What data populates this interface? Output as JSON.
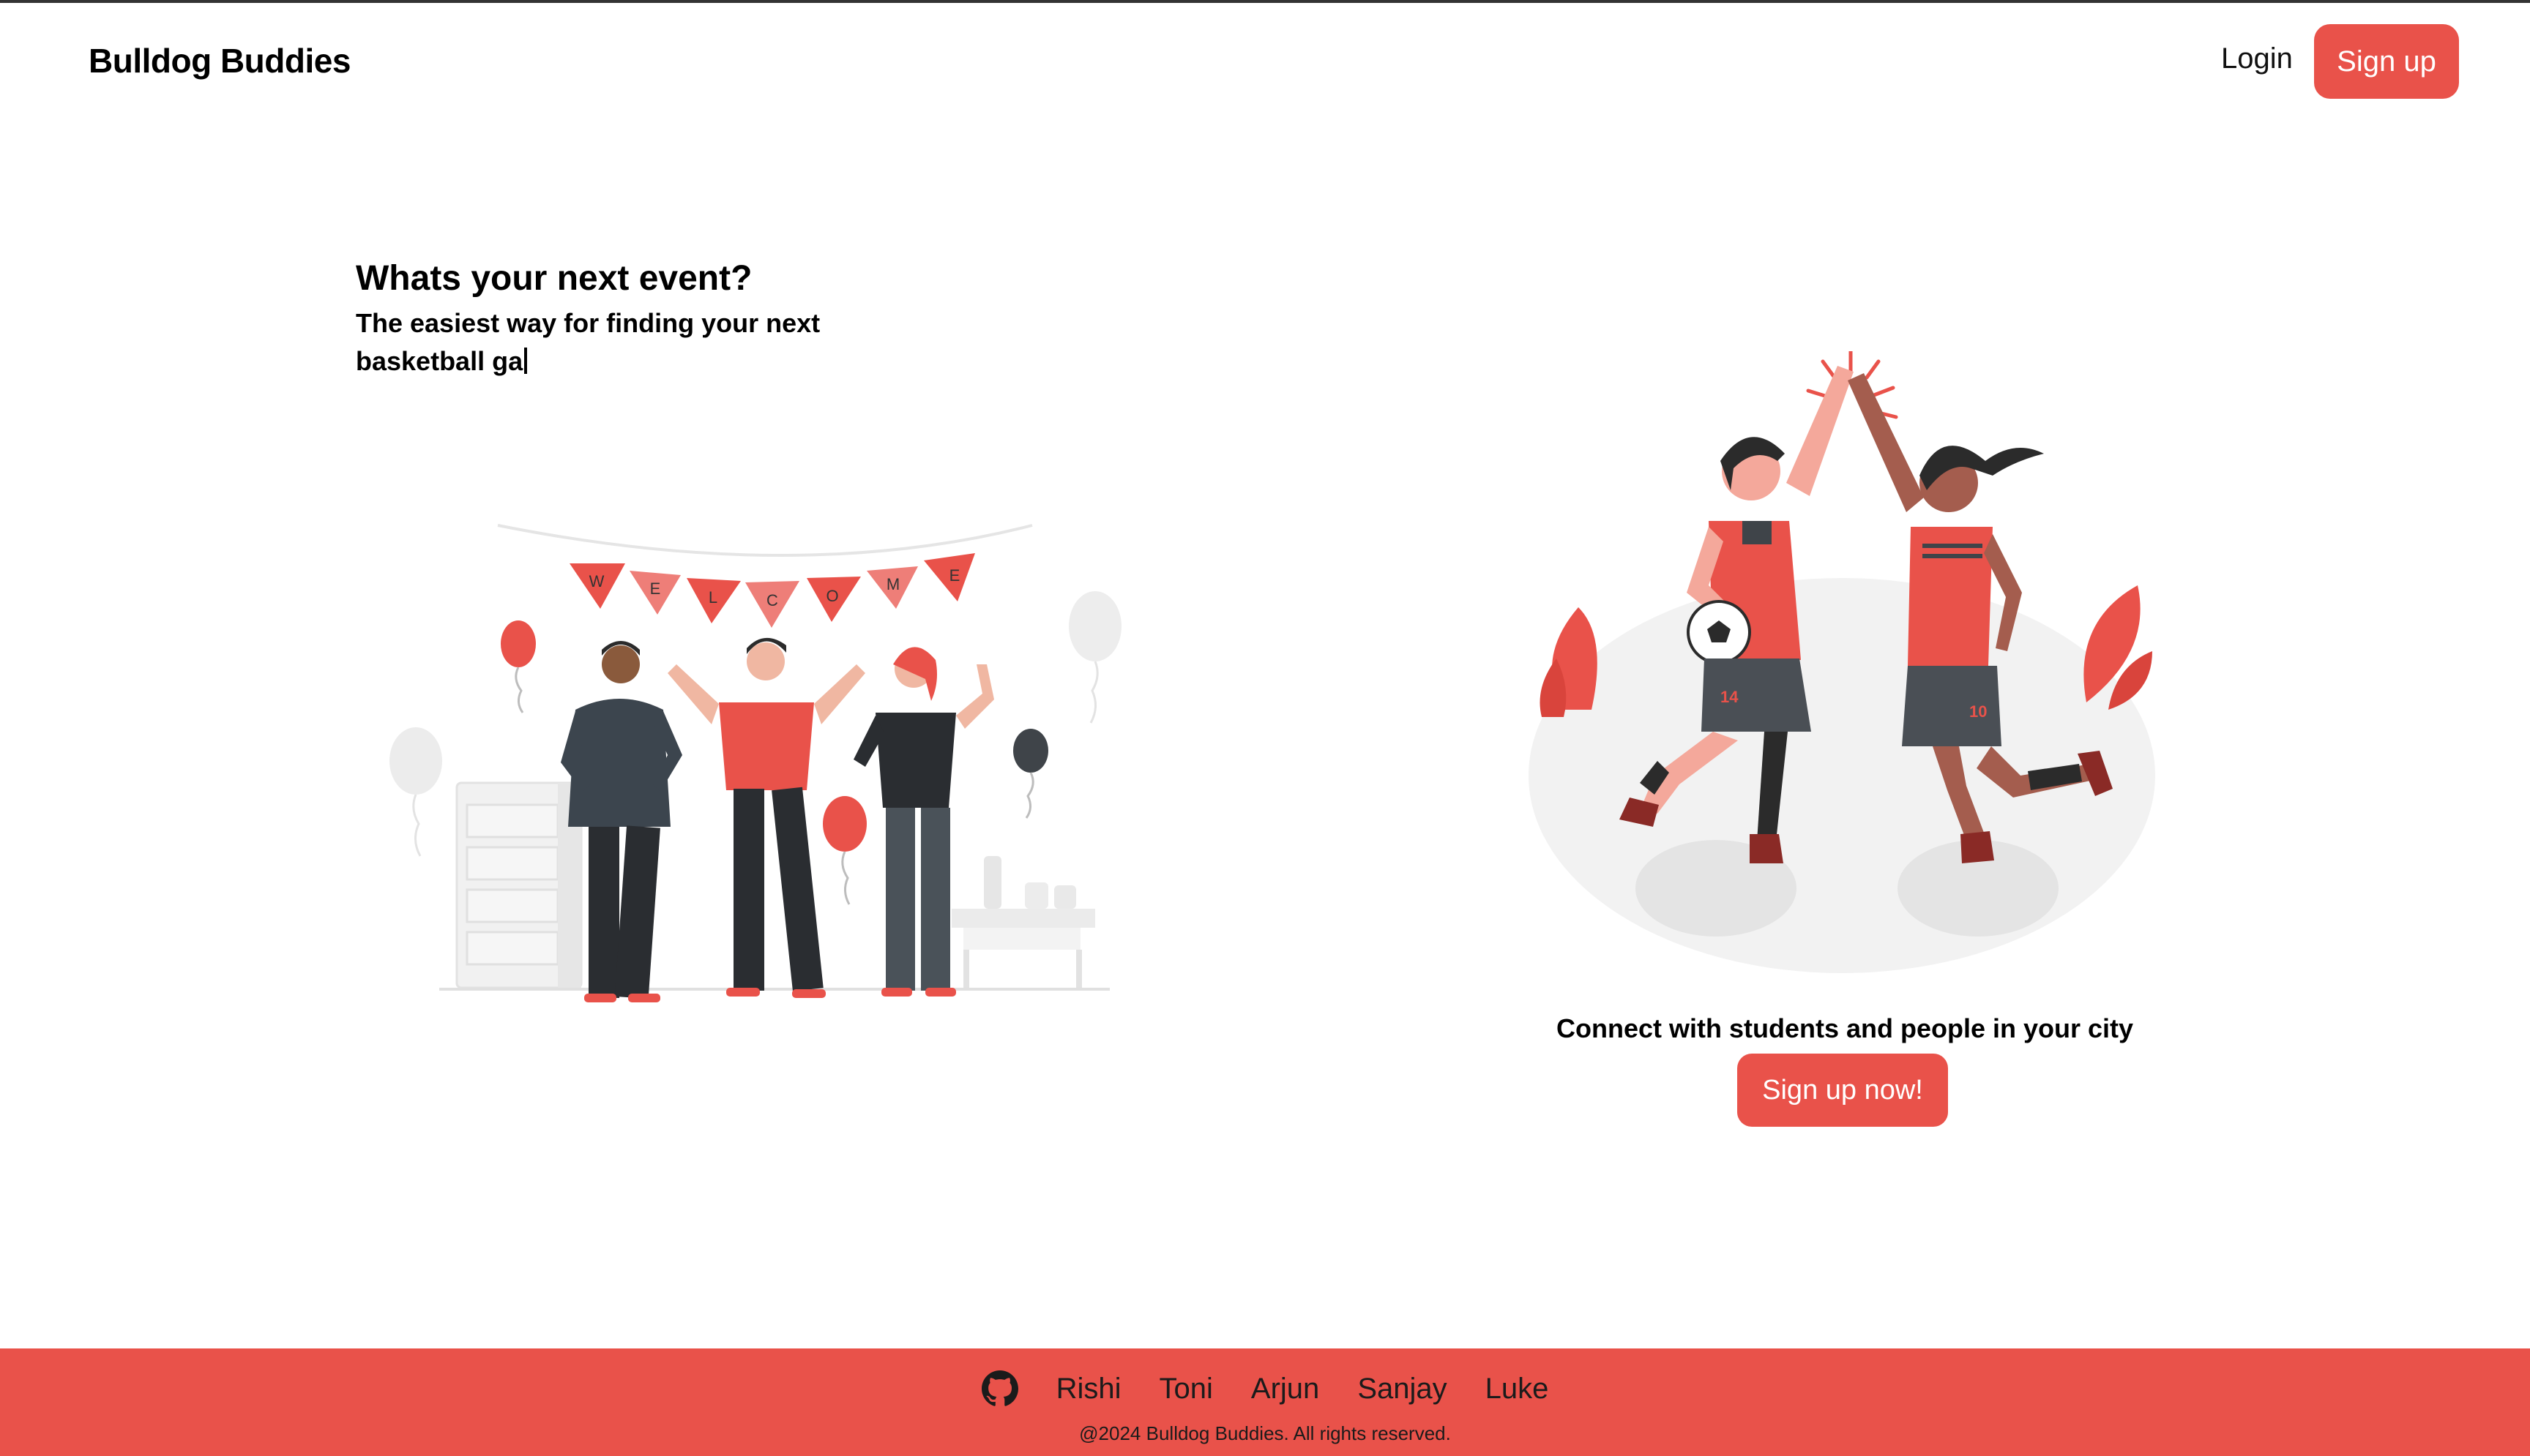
{
  "nav": {
    "brand": "Bulldog Buddies",
    "login_label": "Login",
    "signup_label": "Sign up"
  },
  "hero": {
    "title": "Whats your next event?",
    "subtitle": "The easiest way for finding your next basketball ga"
  },
  "party_illustration": {
    "banner_letters": [
      "W",
      "E",
      "L",
      "C",
      "O",
      "M",
      "E"
    ]
  },
  "soccer_illustration": {
    "jersey_left_number": "14",
    "jersey_right_number": "10"
  },
  "cta": {
    "text": "Connect with students and people in your city",
    "button_label": "Sign up now!"
  },
  "footer": {
    "icon": "github-icon",
    "names": [
      "Rishi",
      "Toni",
      "Arjun",
      "Sanjay",
      "Luke"
    ],
    "copyright": "@2024 Bulldog Buddies. All rights reserved."
  },
  "colors": {
    "accent": "#e9524a",
    "dark_figure": "#2f353b",
    "light_gray": "#ebebeb"
  }
}
